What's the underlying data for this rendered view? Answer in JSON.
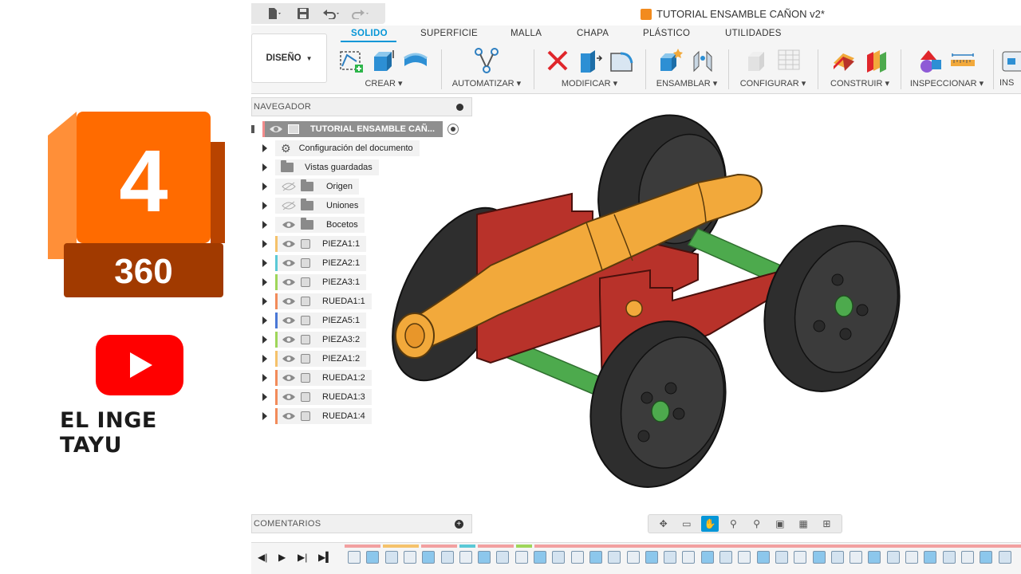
{
  "brand": {
    "logo_number": "4",
    "logo_sub": "360",
    "channel_name": "EL INGE TAYU",
    "colors": {
      "logo_orange": "#ff6b00",
      "logo_dark": "#a13a00",
      "youtube_red": "#ff0000"
    }
  },
  "app": {
    "document_title": "TUTORIAL ENSAMBLE CAÑON v2*",
    "quick_access": [
      "file-icon",
      "save-icon",
      "undo-icon",
      "redo-icon"
    ],
    "workspace_label": "DISEÑO",
    "tabs": [
      {
        "label": "SOLIDO",
        "active": true
      },
      {
        "label": "SUPERFICIE",
        "active": false
      },
      {
        "label": "MALLA",
        "active": false
      },
      {
        "label": "CHAPA",
        "active": false
      },
      {
        "label": "PLÁSTICO",
        "active": false
      },
      {
        "label": "UTILIDADES",
        "active": false
      }
    ],
    "groups": [
      {
        "label": "CREAR ▾",
        "icons": [
          "sketch-icon",
          "extrude-icon",
          "revolve-icon"
        ]
      },
      {
        "label": "AUTOMATIZAR ▾",
        "icons": [
          "automate-icon"
        ]
      },
      {
        "label": "MODIFICAR ▾",
        "icons": [
          "delete-icon",
          "press-pull-icon",
          "fillet-icon"
        ]
      },
      {
        "label": "ENSAMBLAR ▾",
        "icons": [
          "new-component-icon",
          "joint-icon"
        ]
      },
      {
        "label": "CONFIGURAR ▾",
        "icons": [
          "configure-icon",
          "table-icon"
        ]
      },
      {
        "label": "CONSTRUIR ▾",
        "icons": [
          "offset-plane-icon",
          "midplane-icon"
        ]
      },
      {
        "label": "INSPECCIONAR ▾",
        "icons": [
          "shapes-icon",
          "measure-icon"
        ]
      },
      {
        "label": "INS",
        "icons": [
          "insert-icon"
        ]
      }
    ],
    "accent_color": "#0696d7"
  },
  "navigator": {
    "title": "NAVEGADOR",
    "root": "TUTORIAL ENSAMBLE CAÑ...",
    "folders": [
      {
        "label": "Configuración del documento",
        "icon": "gear-icon",
        "eye": false
      },
      {
        "label": "Vistas guardadas",
        "icon": "folder-icon",
        "eye": false
      },
      {
        "label": "Origen",
        "icon": "folder-icon",
        "eye": true
      },
      {
        "label": "Uniones",
        "icon": "folder-icon",
        "eye": true
      },
      {
        "label": "Bocetos",
        "icon": "folder-icon",
        "eye": true
      }
    ],
    "components": [
      {
        "label": "PIEZA1:1",
        "color": "#f5c26b"
      },
      {
        "label": "PIEZA2:1",
        "color": "#5bc9d6"
      },
      {
        "label": "PIEZA3:1",
        "color": "#9fd65a"
      },
      {
        "label": "RUEDA1:1",
        "color": "#f28b5a"
      },
      {
        "label": "PIEZA5:1",
        "color": "#4a78d6"
      },
      {
        "label": "PIEZA3:2",
        "color": "#9fd65a"
      },
      {
        "label": "PIEZA1:2",
        "color": "#f5c26b"
      },
      {
        "label": "RUEDA1:2",
        "color": "#f28b5a"
      },
      {
        "label": "RUEDA1:3",
        "color": "#f28b5a"
      },
      {
        "label": "RUEDA1:4",
        "color": "#f28b5a"
      }
    ]
  },
  "comments": {
    "title": "COMENTARIOS"
  },
  "navbar": [
    "orbit-icon",
    "look-at-icon",
    "pan-icon",
    "zoom-icon",
    "fit-icon",
    "display-icon",
    "grid-icon",
    "viewports-icon"
  ],
  "timeline": {
    "controls": [
      "skip-start-icon",
      "play-icon",
      "step-forward-icon",
      "skip-end-icon"
    ]
  },
  "model_colors": {
    "barrel": "#f2a93b",
    "frame": "#b8322a",
    "axle": "#4daa4d",
    "wheel": "#3a3a3a"
  }
}
